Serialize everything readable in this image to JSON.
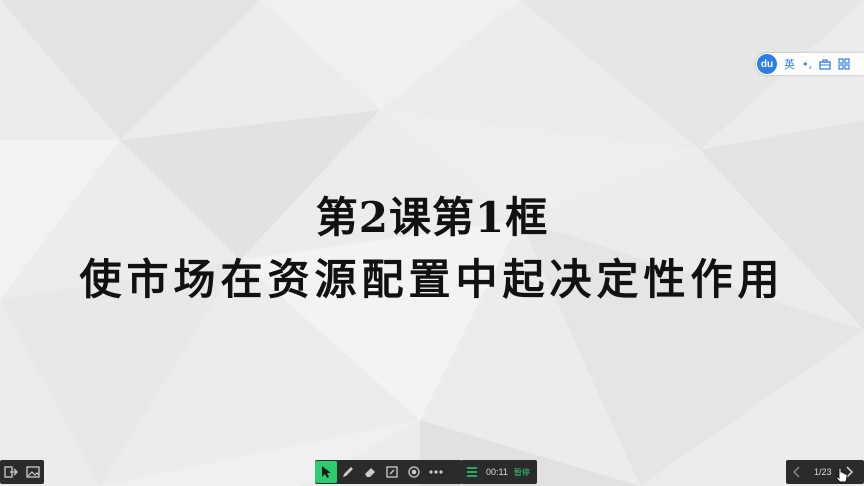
{
  "slide": {
    "title_line1": "第2课第1框",
    "title_line2": "使市场在资源配置中起决定性作用"
  },
  "ime": {
    "logo": "du",
    "language": "英",
    "punct": "•,",
    "icons": [
      "toolbox-icon",
      "grid-icon"
    ]
  },
  "toolbar": {
    "left_icons": [
      "exit-icon",
      "image-icon"
    ],
    "tools": [
      "pointer-icon",
      "pen-icon",
      "eraser-icon",
      "note-icon",
      "record-icon",
      "more-icon"
    ],
    "timer": "00:11",
    "pause_label": "暂停",
    "page_indicator": "1/23"
  },
  "colors": {
    "accent": "#2ecc71",
    "ime_blue": "#2f7ee8",
    "bar_bg": "#2b2b2b"
  }
}
